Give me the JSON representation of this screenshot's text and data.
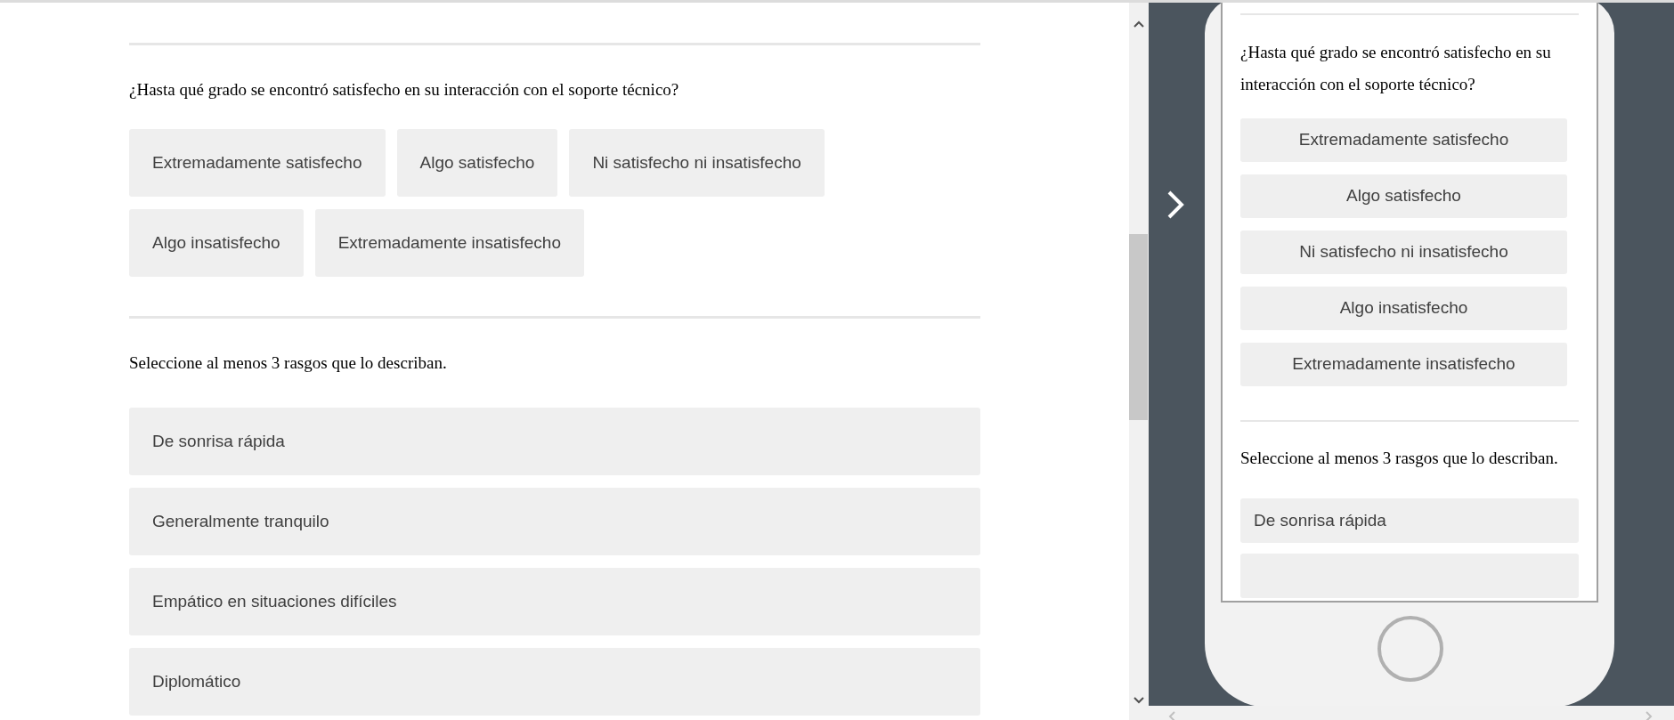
{
  "survey": {
    "questions": [
      {
        "kind": "choice",
        "prompt": "¿Hasta qué grado se encontró satisfecho en su interacción con el soporte técnico?",
        "options": [
          {
            "label": "Extremadamente satisfecho",
            "selected": false
          },
          {
            "label": "Algo satisfecho",
            "selected": false
          },
          {
            "label": "Ni satisfecho ni insatisfecho",
            "selected": false
          },
          {
            "label": "Algo insatisfecho",
            "selected": false
          },
          {
            "label": "Extremadamente insatisfecho",
            "selected": false
          }
        ]
      },
      {
        "kind": "multi",
        "prompt": "Seleccione al menos 3 rasgos que lo describan.",
        "options": [
          {
            "label": "De sonrisa rápida",
            "selected": false
          },
          {
            "label": "Generalmente tranquilo",
            "selected": false
          },
          {
            "label": "Empático en situaciones difíciles",
            "selected": false
          },
          {
            "label": "Diplomático",
            "selected": false
          }
        ]
      }
    ]
  },
  "mobile_preview": {
    "questions": [
      {
        "kind": "choice",
        "prompt": "¿Hasta qué grado se encontró satisfecho en su interacción con el soporte técnico?",
        "options": [
          {
            "label": "Extremadamente satisfecho",
            "selected": false
          },
          {
            "label": "Algo satisfecho",
            "selected": false
          },
          {
            "label": "Ni satisfecho ni insatisfecho",
            "selected": false
          },
          {
            "label": "Algo insatisfecho",
            "selected": false
          },
          {
            "label": "Extremadamente insatisfecho",
            "selected": false
          }
        ]
      },
      {
        "kind": "multi",
        "prompt": "Seleccione al menos 3 rasgos que lo describan.",
        "options": [
          {
            "label": "De sonrisa rápida",
            "selected": false
          }
        ]
      }
    ]
  }
}
